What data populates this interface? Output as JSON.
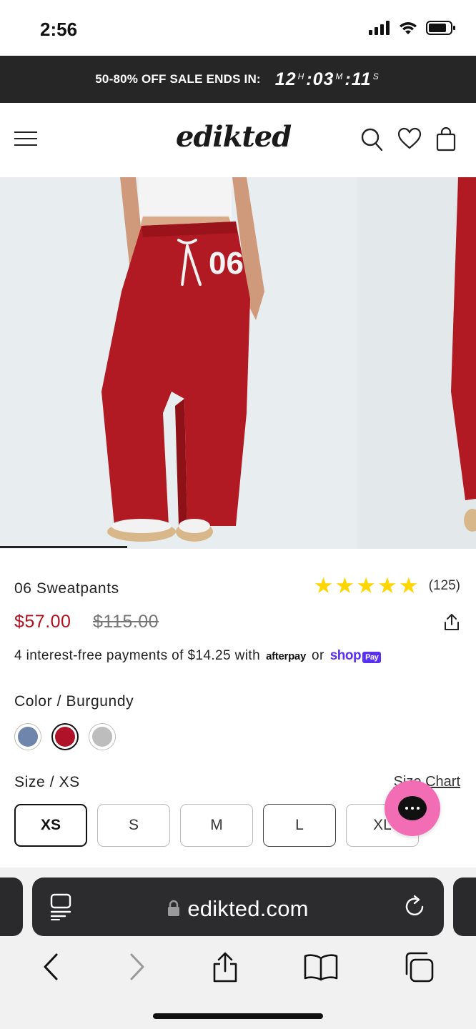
{
  "status_bar": {
    "time": "2:56"
  },
  "promo": {
    "label": "50-80% OFF SALE ENDS IN:",
    "hours": "12",
    "hours_unit": "H",
    "minutes": "03",
    "minutes_unit": "M",
    "seconds": "11",
    "seconds_unit": "S",
    "sep": ":"
  },
  "header": {
    "logo": "edikted"
  },
  "product": {
    "title": "06 Sweatpants",
    "rating_stars": 5,
    "review_count": "(125)",
    "price": "$57.00",
    "compare_price": "$115.00",
    "installments_text": "4 interest-free payments of $14.25 with",
    "afterpay_logo": "afterpay",
    "or_text": "or",
    "shop_logo": "shop",
    "pay_badge": "Pay",
    "color_label": "Color",
    "color_sep": " / ",
    "color_value": "Burgundy",
    "swatches": [
      {
        "name": "Blue",
        "color": "#6f85ab"
      },
      {
        "name": "Burgundy",
        "color": "#b0122a",
        "selected": true
      },
      {
        "name": "Grey",
        "color": "#bdbdbd"
      }
    ],
    "size_label": "Size",
    "size_sep": " / ",
    "size_value": "XS",
    "size_chart": "Size Chart",
    "sizes": [
      "XS",
      "S",
      "M",
      "L",
      "XL"
    ]
  },
  "browser": {
    "url": "edikted.com"
  },
  "colors": {
    "price_red": "#b2101e",
    "banner_bg": "#262626",
    "chat_pink": "#f26db4",
    "star": "#ffd600",
    "shop_purple": "#5a31f4"
  }
}
